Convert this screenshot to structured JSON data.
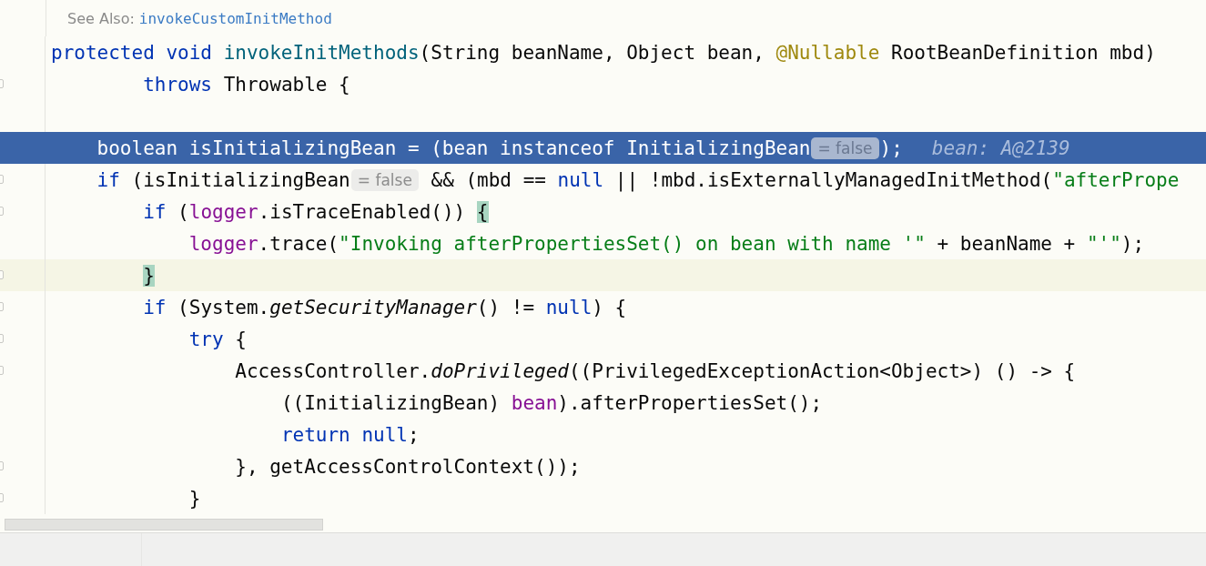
{
  "doc": {
    "label": "See Also:",
    "link": "invokeCustomInitMethod"
  },
  "lines": [
    {
      "selected": false,
      "caret_line": false,
      "fold_marker": false,
      "segments": [
        {
          "kind": "code",
          "tokens": [
            {
              "t": "protected void ",
              "kind": "kw"
            },
            {
              "t": "invokeInitMethods",
              "kind": "decl"
            },
            {
              "t": "(String beanName, Object bean, ",
              "kind": "plain"
            },
            {
              "t": "@Nullable",
              "kind": "ann"
            },
            {
              "t": " RootBeanDefinition mbd)",
              "kind": "plain"
            }
          ]
        }
      ]
    },
    {
      "selected": false,
      "caret_line": false,
      "fold_marker": true,
      "segments": [
        {
          "kind": "code",
          "tokens": [
            {
              "t": "        throws",
              "kind": "kw"
            },
            {
              "t": " Throwable {",
              "kind": "plain"
            }
          ]
        }
      ]
    },
    {
      "selected": false,
      "caret_line": false,
      "fold_marker": false
    },
    {
      "selected": true,
      "caret_line": false,
      "fold_marker": false,
      "segments": [
        {
          "kind": "code",
          "tokens": [
            {
              "t": "    boolean isInitializingBean = (bean instanceof InitializingBean",
              "kind": "plain"
            }
          ]
        },
        {
          "kind": "hint",
          "text": "= false"
        },
        {
          "kind": "code",
          "tokens": [
            {
              "t": ");",
              "kind": "plain"
            }
          ]
        },
        {
          "kind": "debug",
          "text": "bean: A@2139"
        }
      ]
    },
    {
      "selected": false,
      "caret_line": false,
      "fold_marker": true,
      "segments": [
        {
          "kind": "code",
          "tokens": [
            {
              "t": "    if",
              "kind": "kw"
            },
            {
              "t": " (isInitializingBean",
              "kind": "plain"
            }
          ]
        },
        {
          "kind": "hint",
          "text": "= false"
        },
        {
          "kind": "code",
          "tokens": [
            {
              "t": " && (mbd == ",
              "kind": "plain"
            },
            {
              "t": "null",
              "kind": "kw"
            },
            {
              "t": " || !mbd.isExternallyManagedInitMethod(",
              "kind": "plain"
            },
            {
              "t": "\"afterPrope",
              "kind": "str"
            }
          ]
        }
      ]
    },
    {
      "selected": false,
      "caret_line": false,
      "fold_marker": true,
      "segments": [
        {
          "kind": "code",
          "tokens": [
            {
              "t": "        if",
              "kind": "kw"
            },
            {
              "t": " (",
              "kind": "plain"
            },
            {
              "t": "logger",
              "kind": "field"
            },
            {
              "t": ".isTraceEnabled()) ",
              "kind": "plain"
            },
            {
              "t": "{",
              "kind": "brace"
            }
          ]
        }
      ]
    },
    {
      "selected": false,
      "caret_line": false,
      "fold_marker": false,
      "segments": [
        {
          "kind": "code",
          "tokens": [
            {
              "t": "            logger",
              "kind": "field"
            },
            {
              "t": ".trace(",
              "kind": "plain"
            },
            {
              "t": "\"Invoking afterPropertiesSet() on bean with name '\"",
              "kind": "str"
            },
            {
              "t": " + beanName + ",
              "kind": "plain"
            },
            {
              "t": "\"'\"",
              "kind": "str"
            },
            {
              "t": ");",
              "kind": "plain"
            }
          ]
        }
      ]
    },
    {
      "selected": false,
      "caret_line": true,
      "fold_marker": true,
      "segments": [
        {
          "kind": "code",
          "tokens": [
            {
              "t": "        }",
              "kind": "brace"
            }
          ]
        }
      ]
    },
    {
      "selected": false,
      "caret_line": false,
      "fold_marker": true,
      "segments": [
        {
          "kind": "code",
          "tokens": [
            {
              "t": "        if",
              "kind": "kw"
            },
            {
              "t": " (System.",
              "kind": "plain"
            },
            {
              "t": "getSecurityManager",
              "kind": "static"
            },
            {
              "t": "() != ",
              "kind": "plain"
            },
            {
              "t": "null",
              "kind": "kw"
            },
            {
              "t": ") {",
              "kind": "plain"
            }
          ]
        }
      ]
    },
    {
      "selected": false,
      "caret_line": false,
      "fold_marker": true,
      "segments": [
        {
          "kind": "code",
          "tokens": [
            {
              "t": "            try",
              "kind": "kw"
            },
            {
              "t": " {",
              "kind": "plain"
            }
          ]
        }
      ]
    },
    {
      "selected": false,
      "caret_line": false,
      "fold_marker": true,
      "segments": [
        {
          "kind": "code",
          "tokens": [
            {
              "t": "                AccessController.",
              "kind": "plain"
            },
            {
              "t": "doPrivileged",
              "kind": "static"
            },
            {
              "t": "((PrivilegedExceptionAction<Object>) () -> {",
              "kind": "plain"
            }
          ]
        }
      ]
    },
    {
      "selected": false,
      "caret_line": false,
      "fold_marker": false,
      "segments": [
        {
          "kind": "code",
          "tokens": [
            {
              "t": "                    ((InitializingBean) ",
              "kind": "plain"
            },
            {
              "t": "bean",
              "kind": "field"
            },
            {
              "t": ").afterPropertiesSet();",
              "kind": "plain"
            }
          ]
        }
      ]
    },
    {
      "selected": false,
      "caret_line": false,
      "fold_marker": false,
      "segments": [
        {
          "kind": "code",
          "tokens": [
            {
              "t": "                    return null",
              "kind": "kw"
            },
            {
              "t": ";",
              "kind": "plain"
            }
          ]
        }
      ]
    },
    {
      "selected": false,
      "caret_line": false,
      "fold_marker": true,
      "segments": [
        {
          "kind": "code",
          "tokens": [
            {
              "t": "                }, getAccessControlContext());",
              "kind": "plain"
            }
          ]
        }
      ]
    },
    {
      "selected": false,
      "caret_line": false,
      "fold_marker": true,
      "segments": [
        {
          "kind": "code",
          "tokens": [
            {
              "t": "            }",
              "kind": "plain"
            }
          ]
        }
      ]
    }
  ]
}
